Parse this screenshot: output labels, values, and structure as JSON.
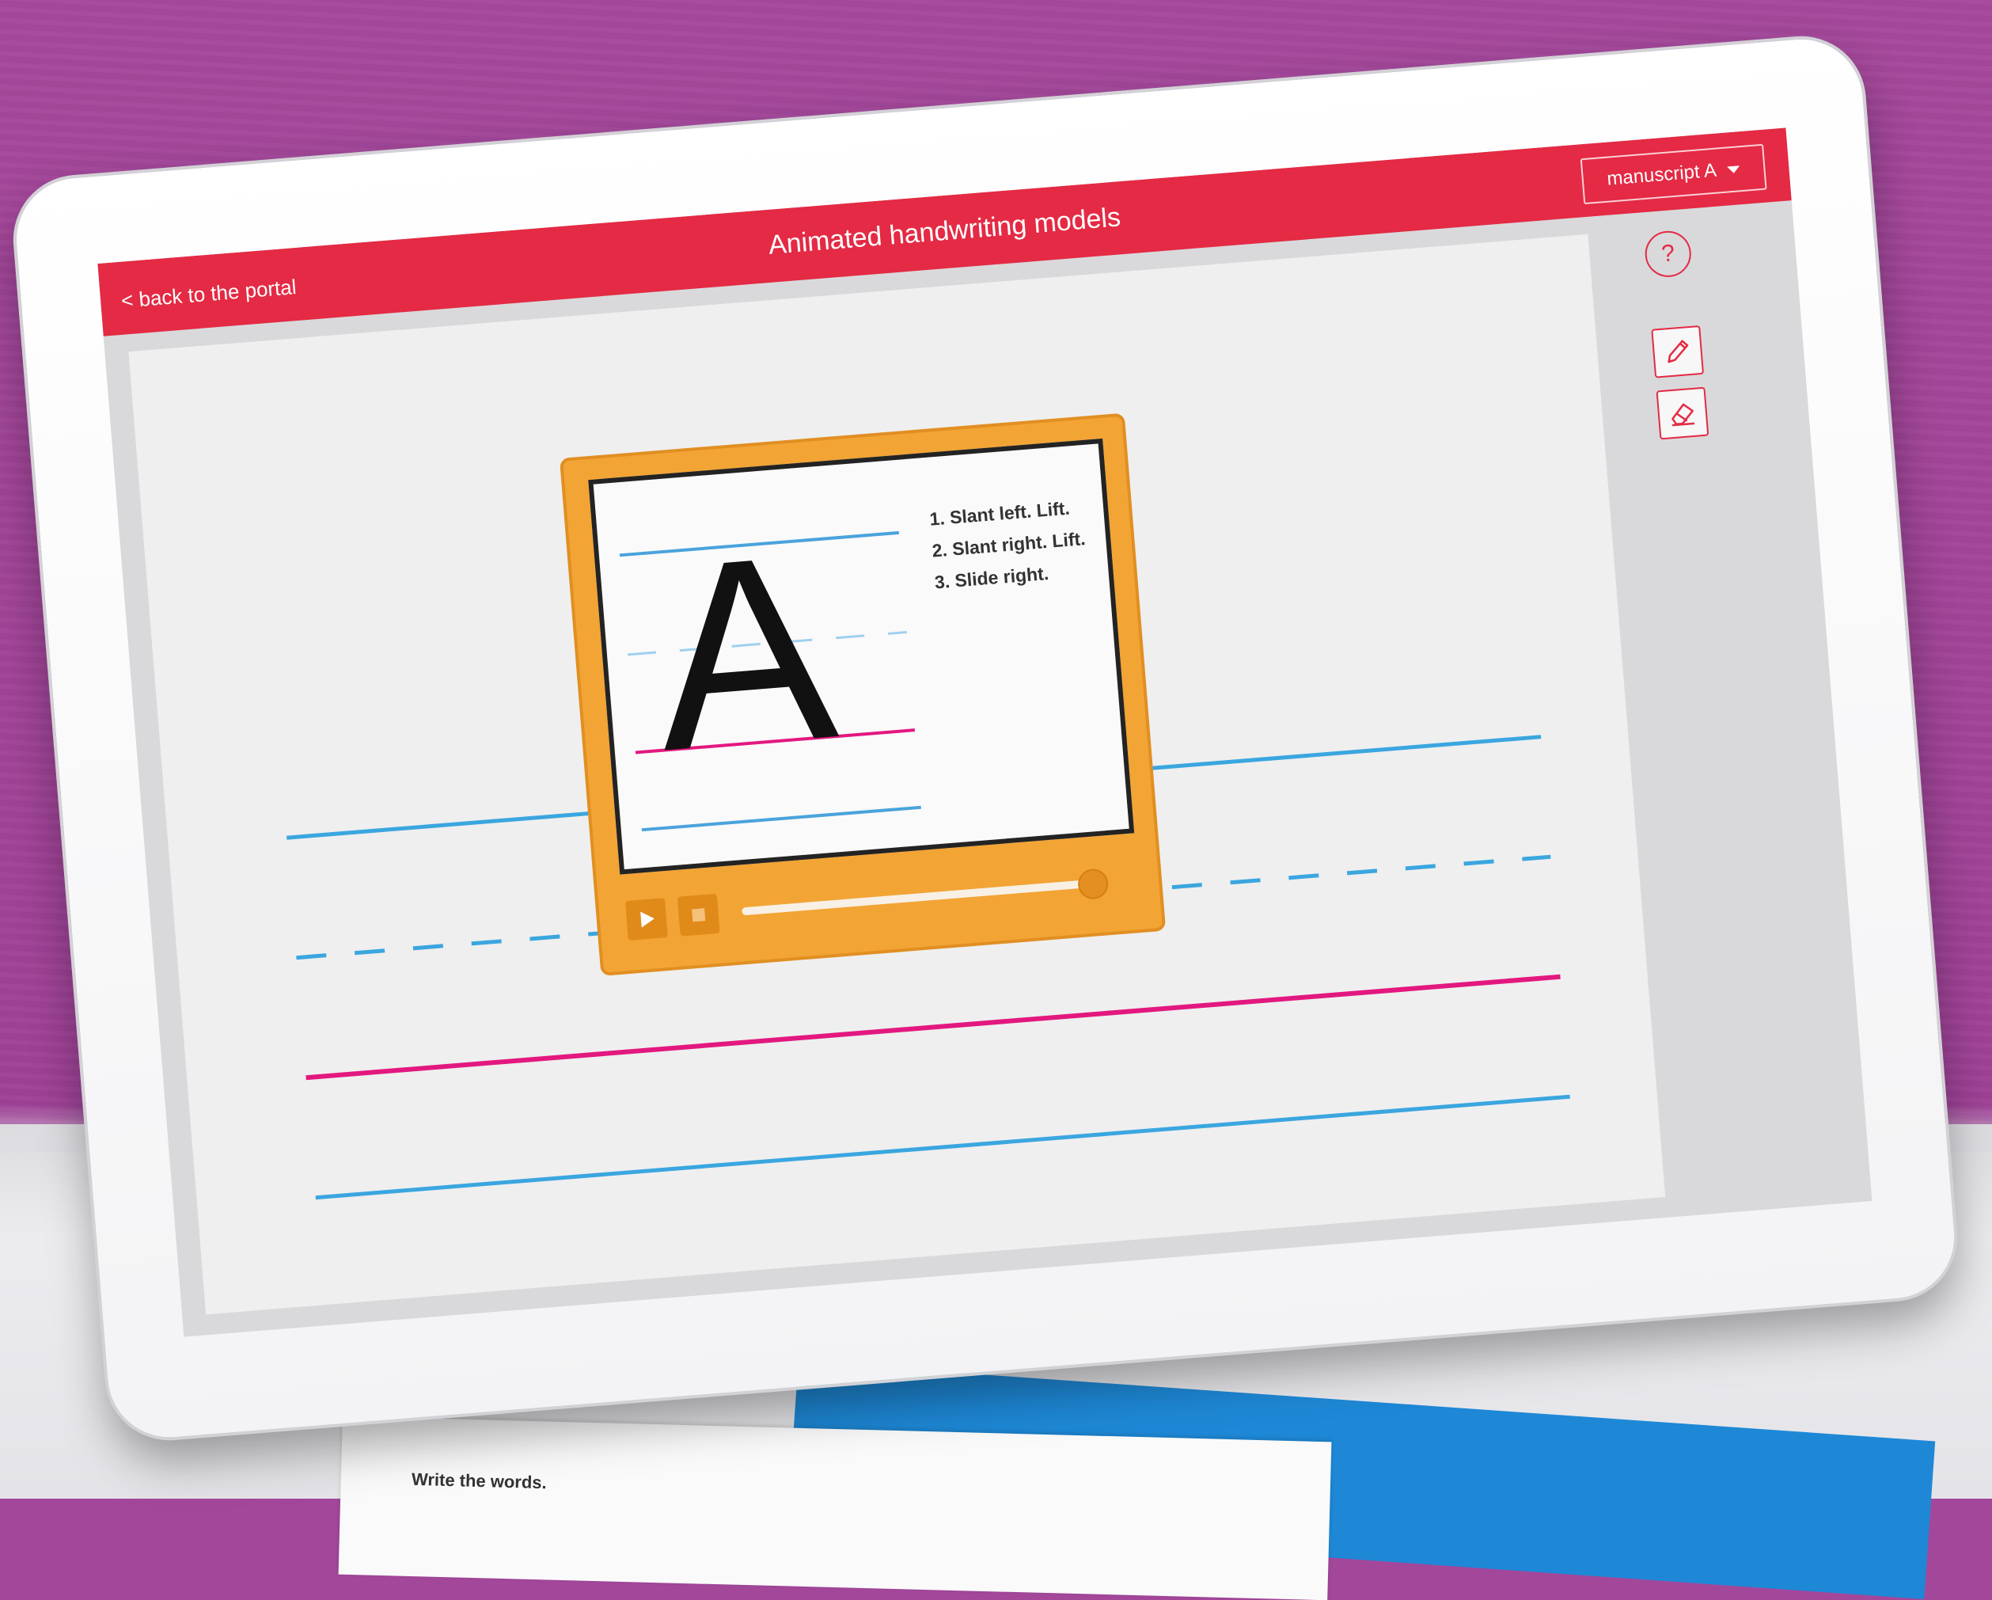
{
  "header": {
    "back_label": "< back to the portal",
    "title": "Animated handwriting models",
    "style_select": "manuscript A"
  },
  "toolbar": {
    "help_label": "?",
    "tools": [
      {
        "icon": "pencil-icon"
      },
      {
        "icon": "eraser-icon"
      }
    ]
  },
  "player": {
    "letter": "A",
    "steps": [
      "1. Slant left. Lift.",
      "2. Slant right. Lift.",
      "3. Slide right."
    ],
    "progress": 1.0,
    "controls": [
      {
        "icon": "play-icon"
      },
      {
        "icon": "stop-icon"
      }
    ]
  },
  "book": {
    "instruction": "Write the words."
  },
  "colors": {
    "header_red": "#e42a44",
    "player_orange": "#f2a434",
    "guide_blue": "#3aa6df",
    "guide_pink": "#e3187f"
  }
}
